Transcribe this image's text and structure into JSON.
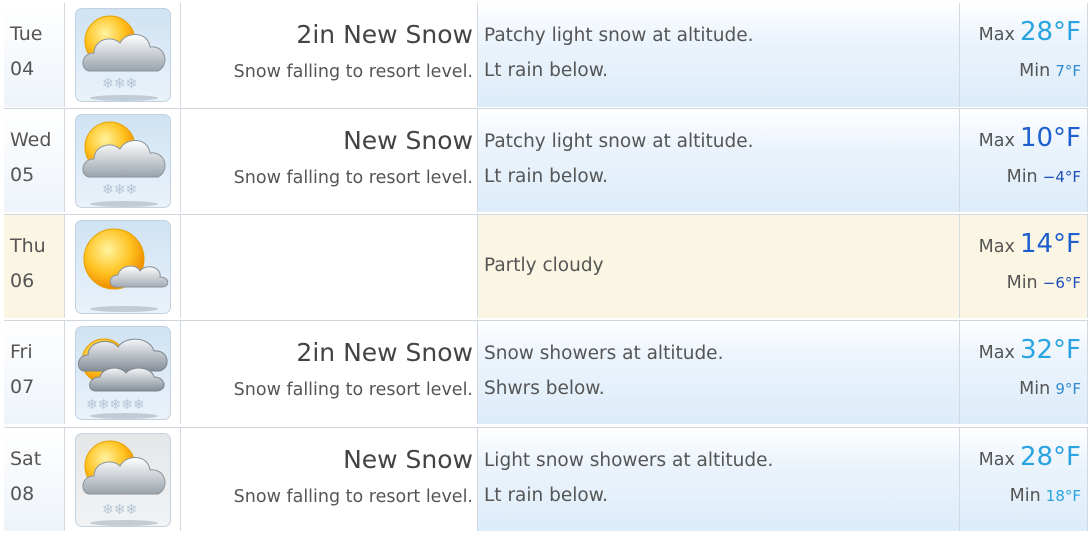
{
  "forecast": [
    {
      "day": "Tue",
      "date": "04",
      "icon": "snow-cloud-sun-icon",
      "snow_title": "2in New Snow",
      "snow_sub": "Snow falling to resort level.",
      "desc_line1": "Patchy light snow at altitude.",
      "desc_line2": "Lt rain below.",
      "max_label": "Max",
      "max_temp": "28°F",
      "max_color": "#29a4e0",
      "min_label": "Min",
      "min_temp": "7°F",
      "min_color": "#2f8ad0"
    },
    {
      "day": "Wed",
      "date": "05",
      "icon": "snow-cloud-sun-icon",
      "snow_title": "New Snow",
      "snow_sub": "Snow falling to resort level.",
      "desc_line1": "Patchy light snow at altitude.",
      "desc_line2": "Lt rain below.",
      "max_label": "Max",
      "max_temp": "10°F",
      "max_color": "#1e5fcf",
      "min_label": "Min",
      "min_temp": "−4°F",
      "min_color": "#1d4fb8"
    },
    {
      "day": "Thu",
      "date": "06",
      "icon": "partly-cloudy-icon",
      "snow_title": "",
      "snow_sub": "",
      "desc_line1": "Partly cloudy",
      "desc_line2": "",
      "max_label": "Max",
      "max_temp": "14°F",
      "max_color": "#1e5fcf",
      "min_label": "Min",
      "min_temp": "−6°F",
      "min_color": "#1d4fb8"
    },
    {
      "day": "Fri",
      "date": "07",
      "icon": "snow-showers-icon",
      "snow_title": "2in New Snow",
      "snow_sub": "Snow falling to resort level.",
      "desc_line1": "Snow showers at altitude.",
      "desc_line2": "Shwrs below.",
      "max_label": "Max",
      "max_temp": "32°F",
      "max_color": "#29a4e0",
      "min_label": "Min",
      "min_temp": "9°F",
      "min_color": "#2f8ad0"
    },
    {
      "day": "Sat",
      "date": "08",
      "icon": "light-snow-sun-icon",
      "snow_title": "New Snow",
      "snow_sub": "Snow falling to resort level.",
      "desc_line1": "Light snow showers at altitude.",
      "desc_line2": "Lt rain below.",
      "max_label": "Max",
      "max_temp": "28°F",
      "max_color": "#29a4e0",
      "min_label": "Min",
      "min_temp": "18°F",
      "min_color": "#29a4e0"
    }
  ]
}
